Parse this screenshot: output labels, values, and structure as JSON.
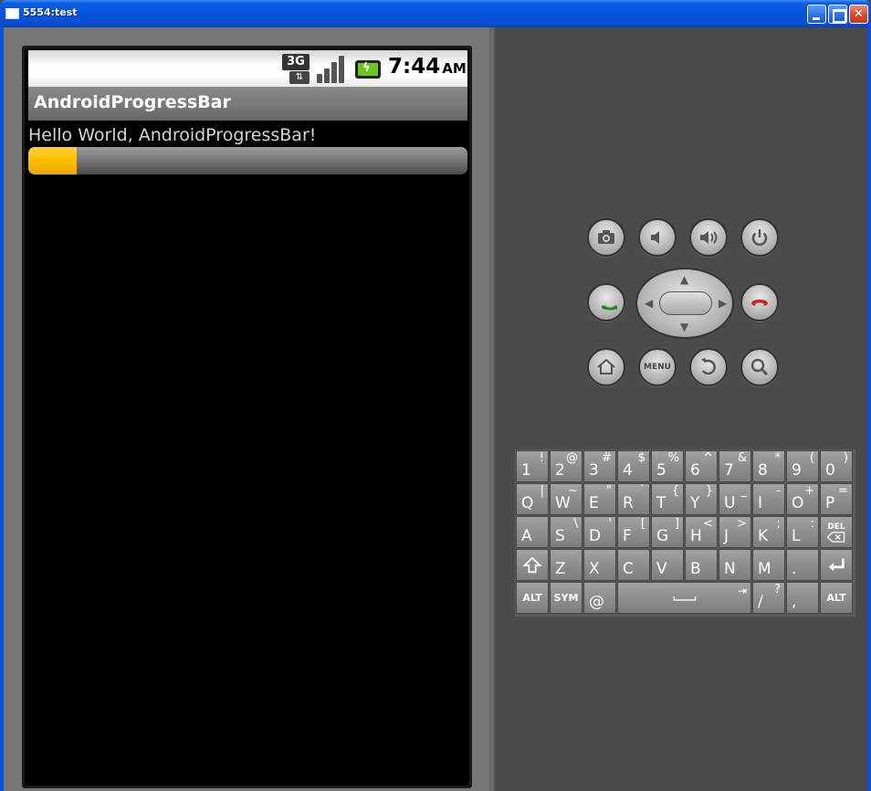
{
  "window": {
    "title": "5554:test"
  },
  "statusbar": {
    "network_label": "3G",
    "time": "7:44",
    "ampm": "AM"
  },
  "app": {
    "title": "AndroidProgressBar",
    "message": "Hello World, AndroidProgressBar!",
    "progress_fraction": 0.11
  },
  "controls": {
    "menu_label": "MENU",
    "icons": [
      "camera-icon",
      "volume-down-icon",
      "volume-up-icon",
      "power-icon",
      "call-icon",
      "end-call-icon",
      "home-icon",
      "back-icon",
      "search-icon"
    ]
  },
  "keyboard": {
    "rows": [
      [
        {
          "m": "1",
          "a": "!"
        },
        {
          "m": "2",
          "a": "@"
        },
        {
          "m": "3",
          "a": "#"
        },
        {
          "m": "4",
          "a": "$"
        },
        {
          "m": "5",
          "a": "%"
        },
        {
          "m": "6",
          "a": "^"
        },
        {
          "m": "7",
          "a": "&"
        },
        {
          "m": "8",
          "a": "*"
        },
        {
          "m": "9",
          "a": "("
        },
        {
          "m": "0",
          "a": ")"
        }
      ],
      [
        {
          "m": "Q",
          "a": "|"
        },
        {
          "m": "W",
          "a": "~"
        },
        {
          "m": "E",
          "a": "\""
        },
        {
          "m": "R",
          "a": "`"
        },
        {
          "m": "T",
          "a": "{"
        },
        {
          "m": "Y",
          "a": "}"
        },
        {
          "m": "U",
          "a": "_"
        },
        {
          "m": "I",
          "a": "-"
        },
        {
          "m": "O",
          "a": "+"
        },
        {
          "m": "P",
          "a": "="
        }
      ],
      [
        {
          "m": "A",
          "a": ""
        },
        {
          "m": "S",
          "a": "\\"
        },
        {
          "m": "D",
          "a": "'"
        },
        {
          "m": "F",
          "a": "["
        },
        {
          "m": "G",
          "a": "]"
        },
        {
          "m": "H",
          "a": "<"
        },
        {
          "m": "J",
          "a": ">"
        },
        {
          "m": "K",
          "a": ";"
        },
        {
          "m": "L",
          "a": ":"
        },
        {
          "m": "DEL",
          "a": ""
        }
      ],
      [
        {
          "m": "shift",
          "a": ""
        },
        {
          "m": "Z",
          "a": ""
        },
        {
          "m": "X",
          "a": ""
        },
        {
          "m": "C",
          "a": ""
        },
        {
          "m": "V",
          "a": ""
        },
        {
          "m": "B",
          "a": ""
        },
        {
          "m": "N",
          "a": ""
        },
        {
          "m": "M",
          "a": ""
        },
        {
          "m": ".",
          "a": ""
        },
        {
          "m": "enter",
          "a": ""
        }
      ]
    ],
    "bottom": {
      "alt_left": "ALT",
      "sym": "SYM",
      "at": "@",
      "slash": "/",
      "slash_alt": "?",
      "comma": ",",
      "alt_right": "ALT",
      "del_label": "DEL"
    }
  }
}
